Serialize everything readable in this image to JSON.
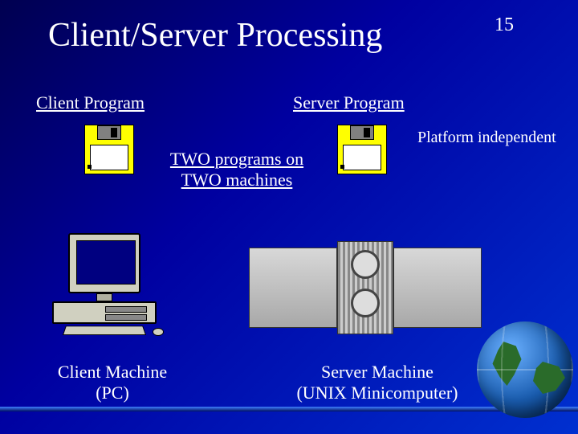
{
  "slide_number": "15",
  "title": "Client/Server Processing",
  "labels": {
    "client_program": "Client Program",
    "server_program": "Server Program",
    "center_line1": "TWO programs on",
    "center_line2": "TWO machines",
    "platform_note": "Platform independent",
    "client_machine_line1": "Client Machine",
    "client_machine_line2": "(PC)",
    "server_machine_line1": "Server Machine",
    "server_machine_line2": "(UNIX Minicomputer)"
  }
}
